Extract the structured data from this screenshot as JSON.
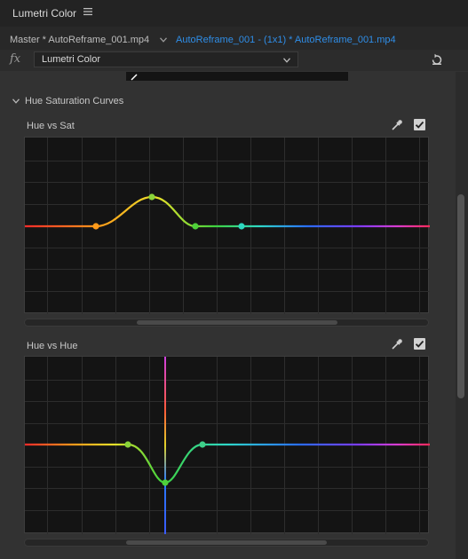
{
  "panel": {
    "title": "Lumetri Color"
  },
  "tabs": {
    "master_label": "Master * AutoReframe_001.mp4",
    "clip_label": "AutoReframe_001 - (1x1) * AutoReframe_001.mp4",
    "active_color": "#2f8ee8"
  },
  "effect": {
    "fx_symbol": "fx",
    "selected": "Lumetri Color"
  },
  "section": {
    "title": "Hue Saturation Curves",
    "expanded": true
  },
  "curves": [
    {
      "id": "hue_vs_sat",
      "label": "Hue vs Sat",
      "enabled": true
    },
    {
      "id": "hue_vs_hue",
      "label": "Hue vs Hue",
      "enabled": true
    }
  ],
  "icons": {
    "menu": "hamburger-menu-icon",
    "reset": "reset-icon",
    "eyedropper": "eyedropper-icon",
    "checkbox": "checkmark-icon",
    "section_toggle": "chevron-down-icon"
  },
  "colors": {
    "panel_bg": "#323232",
    "curve_bg": "#141414",
    "checkbox_fill": "#d2d2d2"
  }
}
